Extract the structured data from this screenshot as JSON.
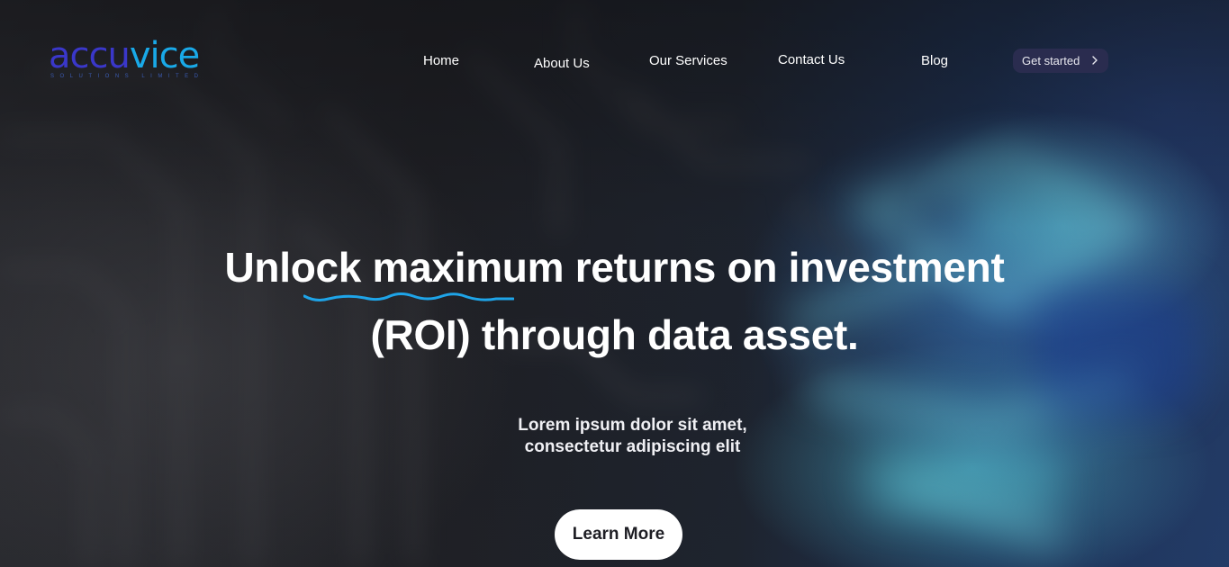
{
  "brand": {
    "logo_part1": "accu",
    "logo_part2": "vice",
    "logo_tagline": "SOLUTIONS LIMITED"
  },
  "nav": {
    "items": [
      {
        "label": "Home"
      },
      {
        "label": "About Us"
      },
      {
        "label": "Our Services"
      },
      {
        "label": "Contact Us"
      },
      {
        "label": "Blog"
      }
    ],
    "cta_label": "Get started",
    "cta_icon": "chevron-right-icon"
  },
  "hero": {
    "title_line1": "Unlock maximum returns on investment",
    "title_line2": "(ROI) through data asset.",
    "subtitle_line1": "Lorem ipsum dolor sit amet,",
    "subtitle_line2": "consectetur adipiscing elit",
    "button_label": "Learn More"
  },
  "colors": {
    "logo_dark": "#3a37c9",
    "logo_light": "#19a9e8",
    "squiggle": "#1ea4e8",
    "cta_bg": "#2a2c4f",
    "button_bg": "#ffffff"
  }
}
